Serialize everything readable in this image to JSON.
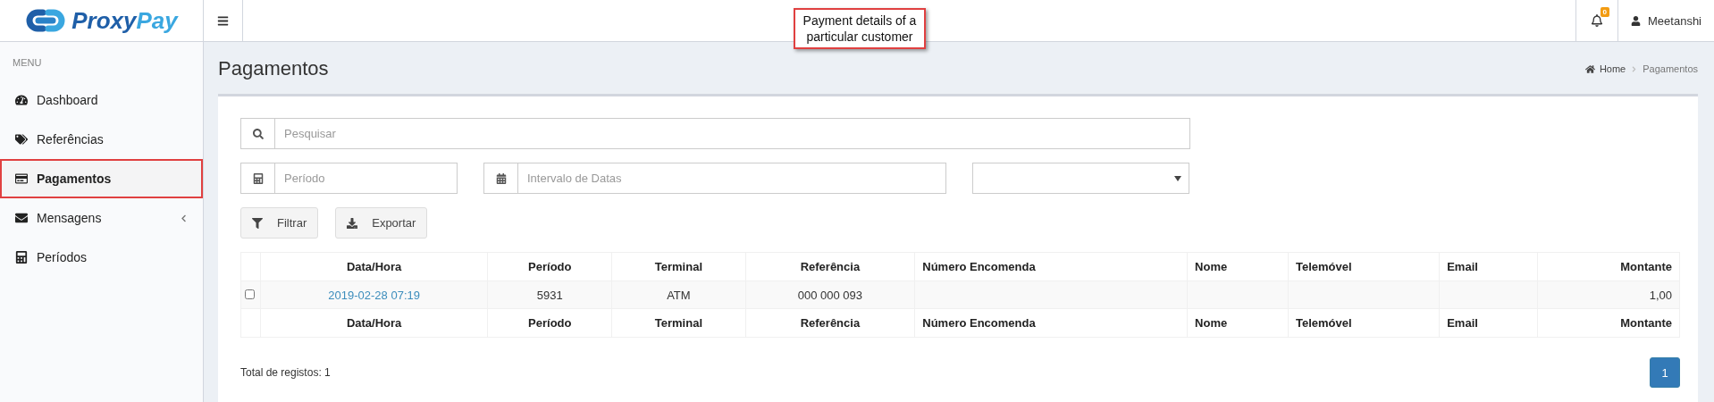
{
  "brand": {
    "name_part1": "Proxy",
    "name_part2": "Pay"
  },
  "header": {
    "notifications": {
      "count": "0"
    },
    "user": "Meetanshi"
  },
  "callout": {
    "text": "Payment details of a particular customer"
  },
  "sidebar": {
    "heading": "MENU",
    "items": [
      {
        "label": "Dashboard",
        "selected": false,
        "has_submenu": false
      },
      {
        "label": "Referências",
        "selected": false,
        "has_submenu": false
      },
      {
        "label": "Pagamentos",
        "selected": true,
        "has_submenu": false
      },
      {
        "label": "Mensagens",
        "selected": false,
        "has_submenu": true
      },
      {
        "label": "Períodos",
        "selected": false,
        "has_submenu": false
      }
    ]
  },
  "page": {
    "title": "Pagamentos",
    "breadcrumb": [
      "Home",
      "Pagamentos"
    ]
  },
  "filters": {
    "search": {
      "placeholder": "Pesquisar"
    },
    "period": {
      "placeholder": "Período"
    },
    "date_range": {
      "placeholder": "Intervalo de Datas"
    },
    "buttons": [
      "Filtrar",
      "Exportar"
    ]
  },
  "table": {
    "columns": [
      "Data/Hora",
      "Período",
      "Terminal",
      "Referência",
      "Número Encomenda",
      "Nome",
      "Telemóvel",
      "Email",
      "Montante"
    ],
    "rows": [
      {
        "checked": false,
        "cells": [
          "2019-02-28 07:19",
          "5931",
          "ATM",
          "000 000 093",
          "",
          "",
          "",
          "",
          "1,00"
        ]
      }
    ],
    "footer_columns": [
      "Data/Hora",
      "Período",
      "Terminal",
      "Referência",
      "Número Encomenda",
      "Nome",
      "Telemóvel",
      "Email",
      "Montante"
    ]
  },
  "footer": {
    "total": "Total de registos: 1",
    "pages": [
      {
        "label": "1",
        "selected": true
      }
    ]
  }
}
